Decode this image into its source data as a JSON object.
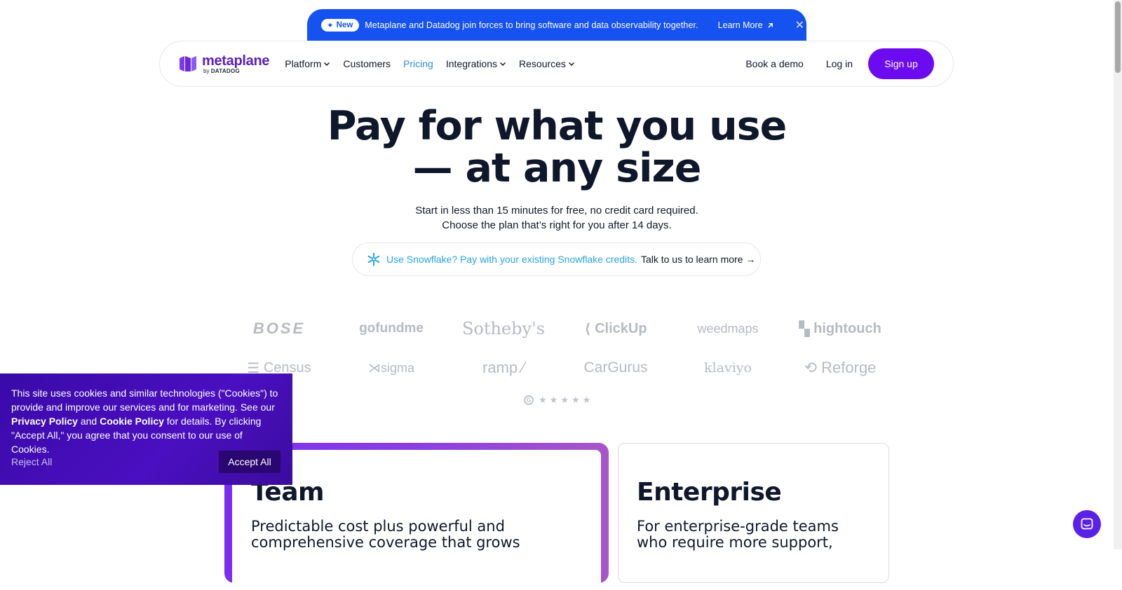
{
  "announcement": {
    "badge": "New",
    "text": "Metaplane and Datadog join forces to bring software and data observability together.",
    "link": "Learn More",
    "close_icon": "close-icon"
  },
  "nav": {
    "logo_word": "metaplane",
    "logo_by": "by",
    "logo_brand": "DATADOG",
    "links": [
      "Platform",
      "Customers",
      "Pricing",
      "Integrations",
      "Resources"
    ],
    "active_link": "Pricing",
    "book_demo": "Book a demo",
    "login": "Log in",
    "signup": "Sign up",
    "accent_color": "#6d0bf0"
  },
  "hero": {
    "title_line1": "Pay for what you use",
    "title_line2": "— at any size",
    "sub_line1": "Start in less than 15 minutes for free, no credit card required.",
    "sub_line2": "Choose the plan that’s right for you after 14 days.",
    "snowflake_highlight": "Use Snowflake? Pay with your existing Snowflake credits.",
    "snowflake_cta": "Talk to us to learn more →"
  },
  "customer_logos": [
    "BOSE",
    "gofundme",
    "Sotheby's",
    "ClickUp",
    "weedmaps",
    "hightouch",
    "Census",
    "sigma",
    "ramp",
    "CarGurus",
    "klaviyo",
    "Reforge"
  ],
  "rating": {
    "provider_icon": "g2-icon",
    "stars": 5
  },
  "plans": {
    "team": {
      "title": "Team",
      "desc_line1": "Predictable cost plus powerful and",
      "desc_line2": "comprehensive coverage that grows"
    },
    "enterprise": {
      "title": "Enterprise",
      "desc_line1": "For enterprise-grade teams",
      "desc_line2": "who require more support,"
    }
  },
  "cookie": {
    "text_1": "This site uses cookies and similar technologies (\"Cookies\") to provide and improve our services and for marketing. See our ",
    "privacy_link": "Privacy Policy",
    "text_2": " and ",
    "cookie_link": "Cookie Policy",
    "text_3": " for details. By clicking \"Accept All,\" you agree that you consent to our use of Cookies.",
    "reject": "Reject All",
    "accept": "Accept All"
  }
}
